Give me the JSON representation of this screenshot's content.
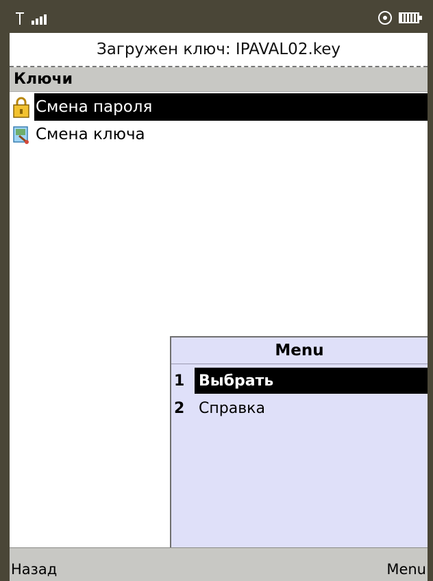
{
  "status_bar": {
    "signal_icon": "signal-antenna-icon",
    "settings_icon": "gear-icon",
    "battery_icon": "battery-icon"
  },
  "ticker": {
    "text": "Загружен ключ: IPAVAL02.key"
  },
  "screen": {
    "title": "Ключи"
  },
  "list": {
    "items": [
      {
        "label": "Смена пароля",
        "icon": "padlock-icon",
        "selected": true
      },
      {
        "label": "Смена ключа",
        "icon": "key-card-icon",
        "selected": false
      }
    ]
  },
  "popup_menu": {
    "title": "Menu",
    "items": [
      {
        "number": "1",
        "label": "Выбрать",
        "selected": true
      },
      {
        "number": "2",
        "label": "Справка",
        "selected": false
      }
    ]
  },
  "softkeys": {
    "left": "Назад",
    "right": "Menu"
  },
  "colors": {
    "frame": "#4a4637",
    "menu_bg": "#dfe0f9",
    "bar_bg": "#c8c8c4",
    "selection": "#000000"
  }
}
